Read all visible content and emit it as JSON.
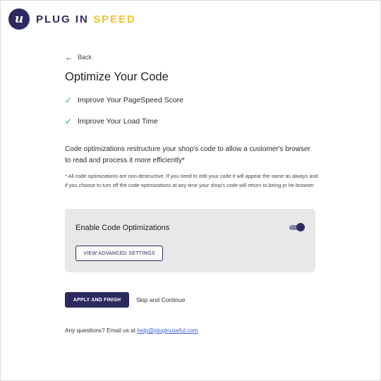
{
  "brand": {
    "mark": "u",
    "name_part1": "PLUG IN",
    "name_part2": "SPEED",
    "colors": {
      "primary": "#2d2a5f",
      "accent": "#f1c232",
      "check": "#3da35d",
      "link": "#3b5bdb"
    }
  },
  "nav": {
    "back_label": "Back",
    "back_icon": "arrow-left-icon"
  },
  "page": {
    "title": "Optimize Your Code",
    "benefits": [
      "Improve Your PageSpeed Score",
      "Improve Your Load Time"
    ],
    "description": "Code optimizations restructure your shop's code to allow a customer's browser to read and process it more efficiently*",
    "footnote": "* All code optimizations are non-destructive. If you need to edit your code it will appear the same as always and if you choose to turn off the code optimizations at any time your shop's code will return to being pr                                      he browser"
  },
  "settings_card": {
    "label": "Enable Code Optimizations",
    "toggle_on": true,
    "advanced_button": "VIEW ADVANCED SETTINGS"
  },
  "actions": {
    "apply_label": "APPLY AND FINISH",
    "skip_label": "Skip and Continue"
  },
  "footer": {
    "text": "Any questions? Email us at",
    "email": "help@pluginuseful.com"
  }
}
